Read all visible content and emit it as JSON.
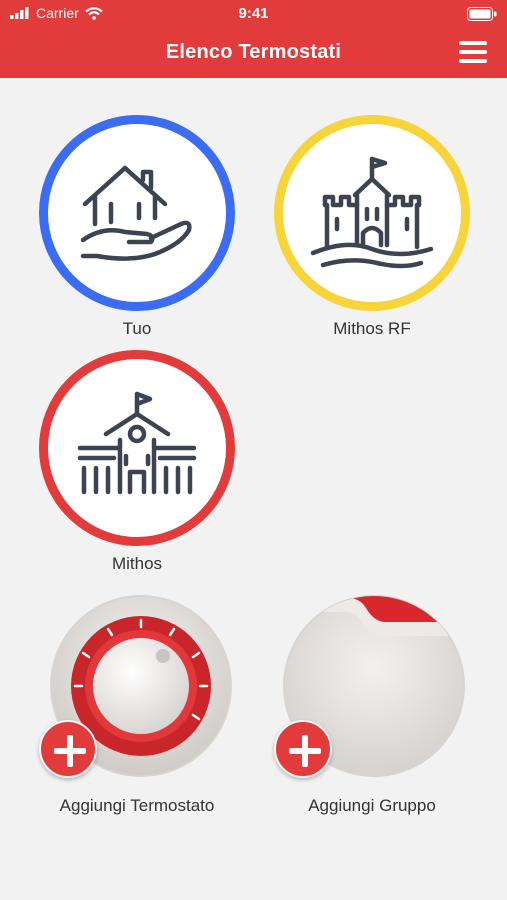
{
  "status_bar": {
    "carrier": "Carrier",
    "time": "9:41"
  },
  "header": {
    "title": "Elenco Termostati"
  },
  "thermostats": [
    {
      "label": "Tuo",
      "icon": "house-in-hand-icon",
      "ring_color": "#3b6cf2"
    },
    {
      "label": "Mithos RF",
      "icon": "castle-icon",
      "ring_color": "#f7d43a"
    },
    {
      "label": "Mithos",
      "icon": "school-building-icon",
      "ring_color": "#e23b3b"
    }
  ],
  "actions": {
    "add_thermostat_label": "Aggiungi Termostato",
    "add_group_label": "Aggiungi Gruppo"
  },
  "colors": {
    "accent": "#e23b3b",
    "background": "#f2f2f2",
    "icon_stroke": "#3b4450"
  }
}
